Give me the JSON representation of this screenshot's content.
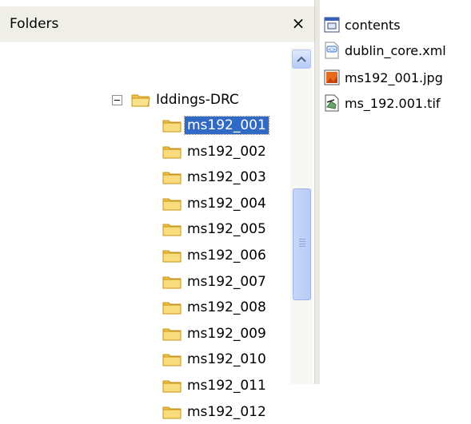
{
  "folders_pane": {
    "title": "Folders",
    "close_symbol": "×",
    "tree": {
      "parent": {
        "label": "Iddings-DRC",
        "expander": "minus"
      },
      "children": [
        {
          "label": "ms192_001",
          "selected": true
        },
        {
          "label": "ms192_002"
        },
        {
          "label": "ms192_003"
        },
        {
          "label": "ms192_004"
        },
        {
          "label": "ms192_005"
        },
        {
          "label": "ms192_006"
        },
        {
          "label": "ms192_007"
        },
        {
          "label": "ms192_008"
        },
        {
          "label": "ms192_009"
        },
        {
          "label": "ms192_010"
        },
        {
          "label": "ms192_011"
        },
        {
          "label": "ms192_012"
        }
      ]
    }
  },
  "files_pane": {
    "items": [
      {
        "label": "contents",
        "icon": "contents-file-icon"
      },
      {
        "label": "dublin_core.xml",
        "icon": "xml-file-icon"
      },
      {
        "label": "ms192_001.jpg",
        "icon": "jpg-file-icon"
      },
      {
        "label": "ms_192.001.tif",
        "icon": "tif-file-icon"
      }
    ]
  },
  "colors": {
    "selection": "#316ac5",
    "header_bg": "#f0efe7",
    "folder_yellow": "#f7d774"
  }
}
